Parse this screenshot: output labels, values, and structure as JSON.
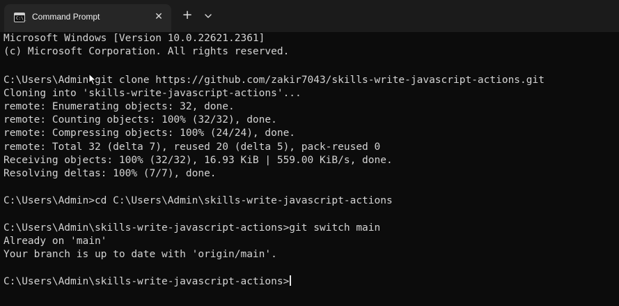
{
  "tab": {
    "title": "Command Prompt",
    "icon": "command-prompt-icon",
    "icon_glyph": "C:\\_",
    "close_glyph": "✕"
  },
  "tabbar": {
    "new_tab_glyph": "+",
    "dropdown_icon": "chevron-down-icon"
  },
  "terminal": {
    "lines": [
      "Microsoft Windows [Version 10.0.22621.2361]",
      "(c) Microsoft Corporation. All rights reserved.",
      "",
      "C:\\Users\\Admin>git clone https://github.com/zakir7043/skills-write-javascript-actions.git",
      "Cloning into 'skills-write-javascript-actions'...",
      "remote: Enumerating objects: 32, done.",
      "remote: Counting objects: 100% (32/32), done.",
      "remote: Compressing objects: 100% (24/24), done.",
      "remote: Total 32 (delta 7), reused 20 (delta 5), pack-reused 0",
      "Receiving objects: 100% (32/32), 16.93 KiB | 559.00 KiB/s, done.",
      "Resolving deltas: 100% (7/7), done.",
      "",
      "C:\\Users\\Admin>cd C:\\Users\\Admin\\skills-write-javascript-actions",
      "",
      "C:\\Users\\Admin\\skills-write-javascript-actions>git switch main",
      "Already on 'main'",
      "Your branch is up to date with 'origin/main'.",
      "",
      "C:\\Users\\Admin\\skills-write-javascript-actions>"
    ]
  },
  "colors": {
    "background": "#0c0c0c",
    "tabbar": "#1b1b1b",
    "tab_active": "#262626",
    "text": "#d4d4d4"
  }
}
